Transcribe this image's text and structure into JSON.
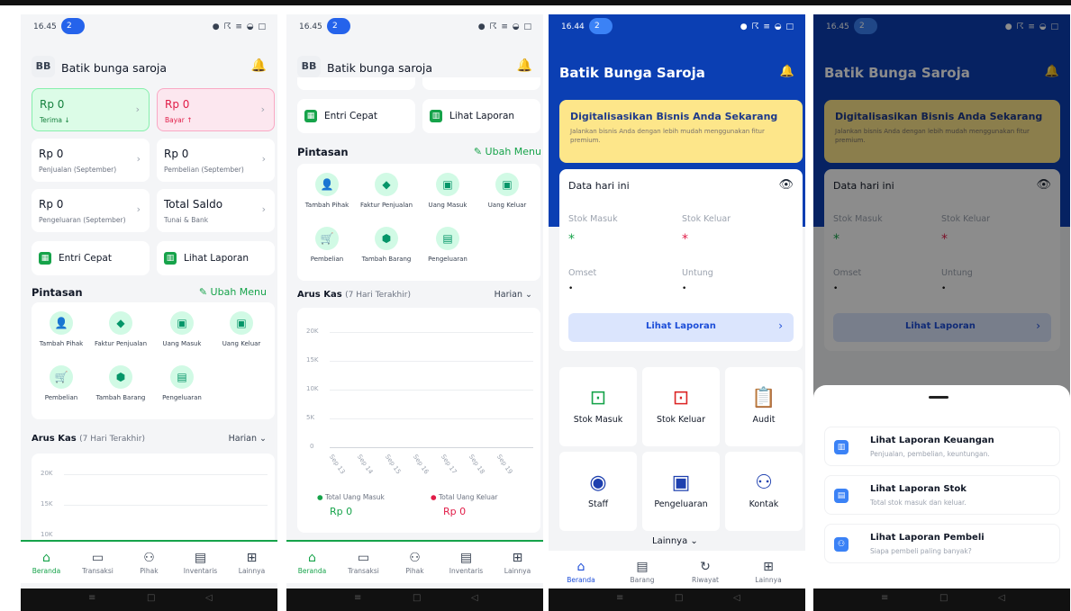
{
  "status": {
    "time1": "16.45",
    "time3": "16.44",
    "badge": "2",
    "icons": "● ☈ ≡ ◒ □"
  },
  "business": {
    "initials": "BB",
    "name": "Batik bunga saroja",
    "title": "Batik Bunga Saroja"
  },
  "summary": [
    {
      "amount": "Rp 0",
      "label": "Terima ↓"
    },
    {
      "amount": "Rp 0",
      "label": "Bayar ↑"
    },
    {
      "amount": "Rp 0",
      "label": "Penjualan (September)"
    },
    {
      "amount": "Rp 0",
      "label": "Pembelian (September)"
    },
    {
      "amount": "Rp 0",
      "label": "Pengeluaran (September)"
    },
    {
      "amount": "Total Saldo",
      "label": "Tunai & Bank"
    }
  ],
  "quick": {
    "entri": "Entri Cepat",
    "laporan": "Lihat Laporan"
  },
  "pintasan": {
    "title": "Pintasan",
    "edit": "Ubah Menu",
    "items": [
      "Tambah Pihak",
      "Faktur Penjualan",
      "Uang Masuk",
      "Uang Keluar",
      "Pembelian",
      "Tambah Barang",
      "Pengeluaran"
    ]
  },
  "aruskas": {
    "title": "Arus Kas",
    "period": "(7 Hari Terakhir)",
    "filter": "Harian",
    "ticks": [
      "20K",
      "15K",
      "10K",
      "5K",
      "0"
    ],
    "days": [
      "Sep 13",
      "Sep 14",
      "Sep 15",
      "Sep 16",
      "Sep 17",
      "Sep 18",
      "Sep 19"
    ],
    "in_label": "Total Uang Masuk",
    "out_label": "Total Uang Keluar",
    "in_val": "Rp 0",
    "out_val": "Rp 0"
  },
  "nav1": [
    "Beranda",
    "Transaksi",
    "Pihak",
    "Inventaris",
    "Lainnya"
  ],
  "promo": {
    "title": "Digitalisasikan Bisnis Anda Sekarang",
    "desc": "Jalankan bisnis Anda dengan lebih mudah menggunakan fitur premium."
  },
  "today": {
    "title": "Data hari ini",
    "stok_masuk": "Stok Masuk",
    "stok_keluar": "Stok Keluar",
    "omset": "Omset",
    "untung": "Untung",
    "star": "*",
    "dot": "•",
    "button": "Lihat Laporan"
  },
  "menu": [
    "Stok Masuk",
    "Stok Keluar",
    "Audit",
    "Staff",
    "Pengeluaran",
    "Kontak"
  ],
  "lainnya": "Lainnya",
  "nav3": [
    "Beranda",
    "Barang",
    "Riwayat",
    "Lainnya"
  ],
  "sheet": [
    {
      "title": "Lihat Laporan Keuangan",
      "desc": "Penjualan, pembelian, keuntungan."
    },
    {
      "title": "Lihat Laporan Stok",
      "desc": "Total stok masuk dan keluar."
    },
    {
      "title": "Lihat Laporan Pembeli",
      "desc": "Siapa pembeli paling banyak?"
    }
  ]
}
